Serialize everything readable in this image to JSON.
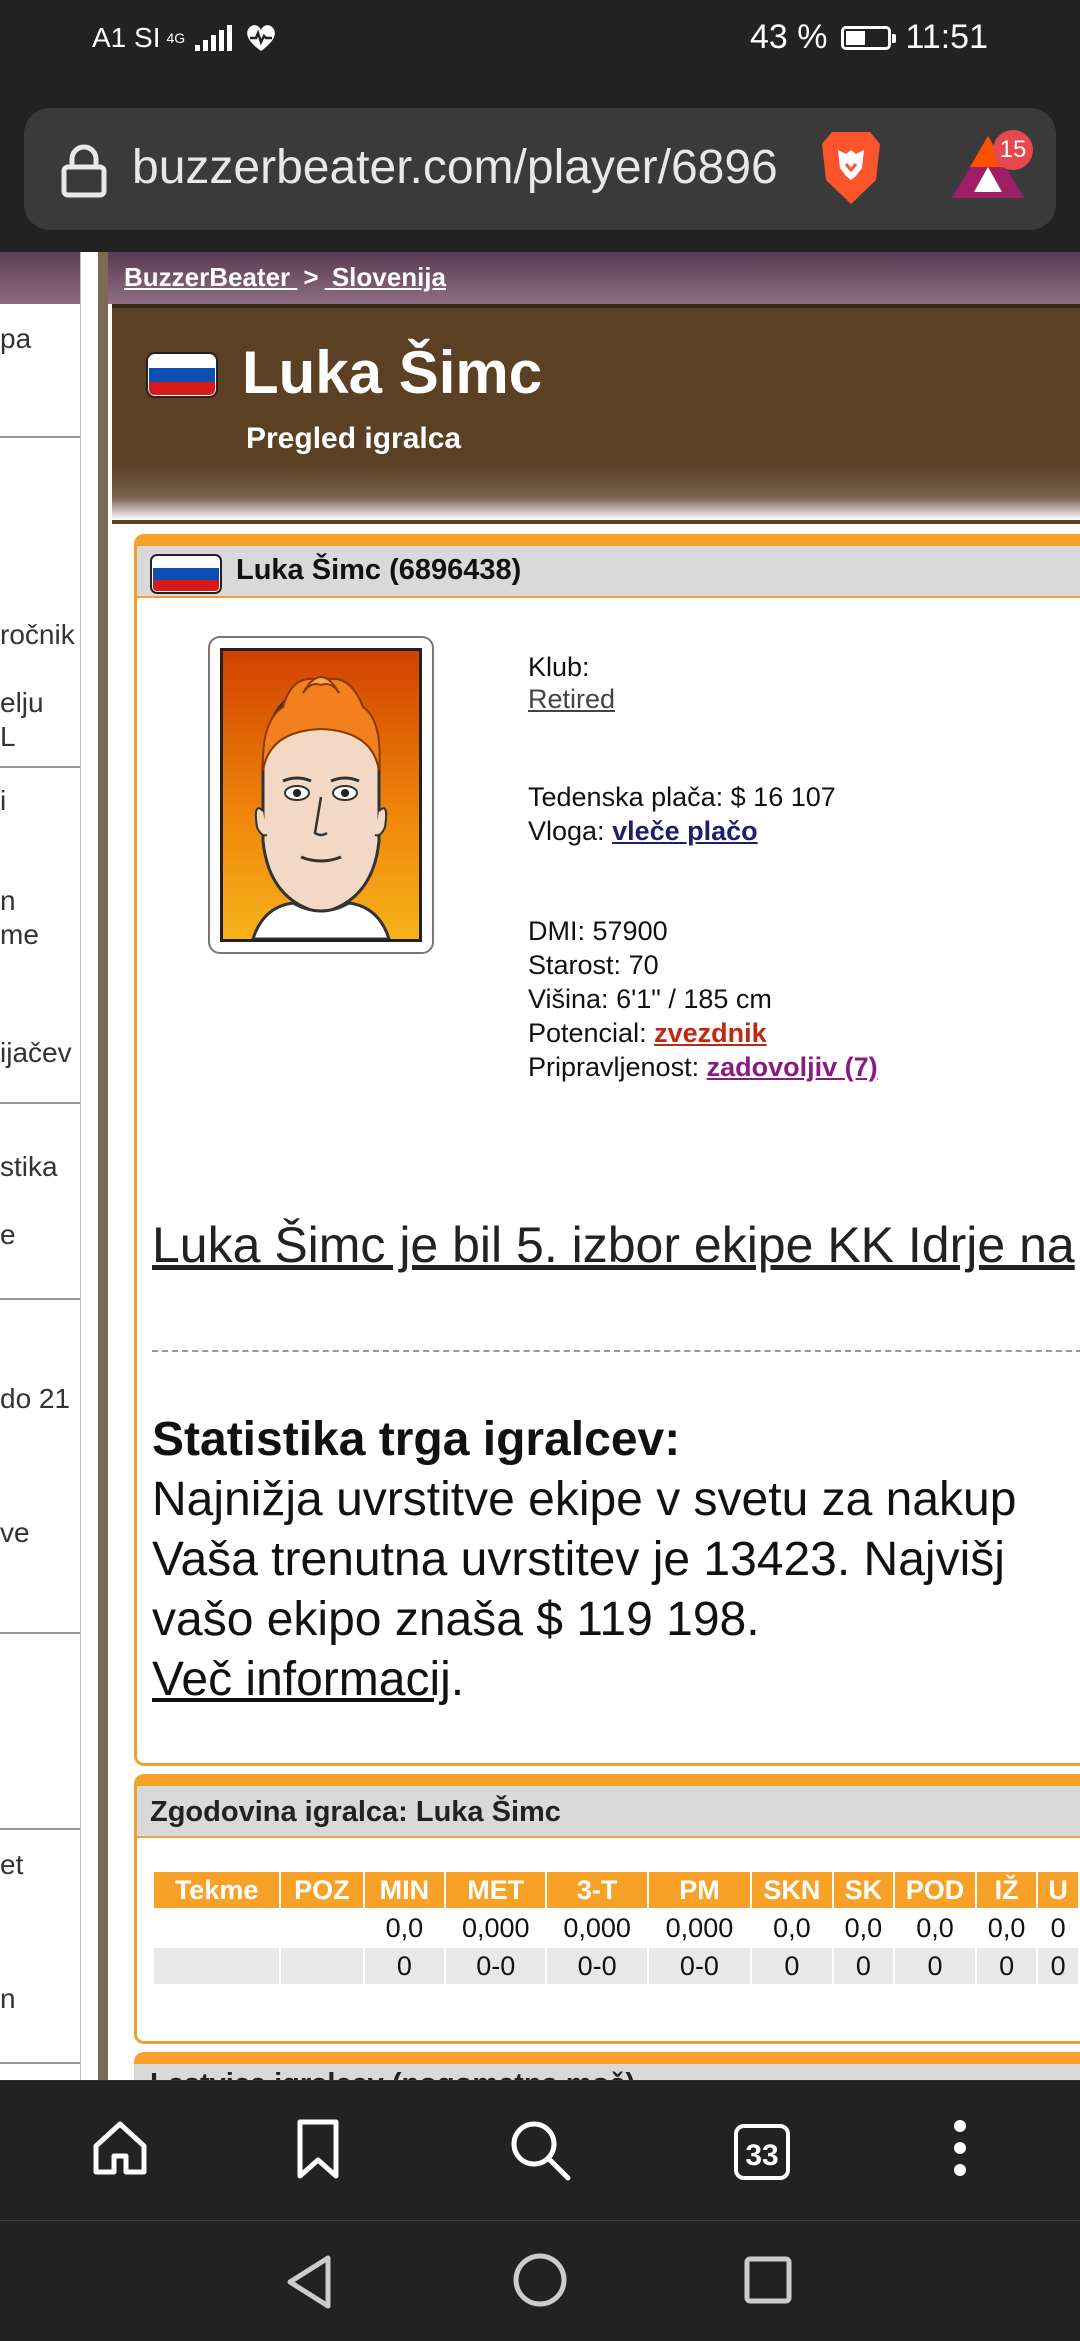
{
  "status_bar": {
    "carrier": "A1 SI",
    "network": "4G",
    "battery_percent": "43 %",
    "battery_level": 0.43,
    "time": "11:51"
  },
  "browser": {
    "url": "buzzerbeater.com/player/6896",
    "notification_count": "15",
    "tab_count": "33",
    "icons": [
      "lock-icon",
      "brave-lion-icon",
      "bat-rewards-icon",
      "home-icon",
      "bookmark-icon",
      "search-icon",
      "tabs-icon",
      "more-menu-icon"
    ]
  },
  "sidebar": {
    "fragments": [
      "pa",
      "ročnik",
      "elju",
      "L",
      "i",
      "n",
      "me",
      "ijačev",
      "stika",
      "e",
      "do 21",
      "ve",
      "et",
      "n"
    ]
  },
  "breadcrumb": {
    "site": "BuzzerBeater",
    "separator": ">",
    "country": "Slovenija"
  },
  "header": {
    "player_name": "Luka Šimc",
    "subtitle": "Pregled igralca"
  },
  "player_panel": {
    "heading": "Luka Šimc (6896438)",
    "club_label": "Klub:",
    "club_value": "Retired",
    "salary_label": "Tedenska plača:",
    "salary_value": "$ 16 107",
    "role_label": "Vloga:",
    "role_value": "vleče plačo",
    "dmi_label": "DMI:",
    "dmi_value": "57900",
    "age_label": "Starost:",
    "age_value": "70",
    "height_label": "Višina:",
    "height_value": "6'1\" / 185 cm",
    "potential_label": "Potencial:",
    "potential_value": "zvezdnik",
    "readiness_label": "Pripravljenost:",
    "readiness_value": "zadovoljiv (7)",
    "draft_text": "Luka Šimc je bil 5. izbor ekipe KK Idrje na",
    "market_title": "Statistika trga igralcev:",
    "market_line_1": "Najnižja uvrstitve ekipe v svetu za nakup",
    "market_line_2": "Vaša trenutna uvrstitev je 13423. Najvišj",
    "market_line_3": "vašo ekipo znaša $ 119 198.",
    "more_info": "Več informacij",
    "more_info_suffix": "."
  },
  "history_panel": {
    "heading": "Zgodovina igralca: Luka Šimc",
    "columns": [
      "Tekme",
      "POZ",
      "MIN",
      "MET",
      "3-T",
      "PM",
      "SKN",
      "SK",
      "POD",
      "IŽ",
      "U"
    ],
    "rows": [
      [
        "",
        "",
        "0,0",
        "0,000",
        "0,000",
        "0,000",
        "0,0",
        "0,0",
        "0,0",
        "0,0",
        "0"
      ],
      [
        "",
        "",
        "0",
        "0-0",
        "0-0",
        "0-0",
        "0",
        "0",
        "0",
        "0",
        "0"
      ]
    ]
  },
  "next_panel": {
    "heading": "Lestvica igralcev (nogometna moč)"
  },
  "colors": {
    "accent_orange": "#f7a128",
    "header_brown": "#5b4023",
    "breadcrumb_purple": "#6e4b63",
    "potential_red": "#c0280f",
    "readiness_purple": "#8b1a80"
  }
}
